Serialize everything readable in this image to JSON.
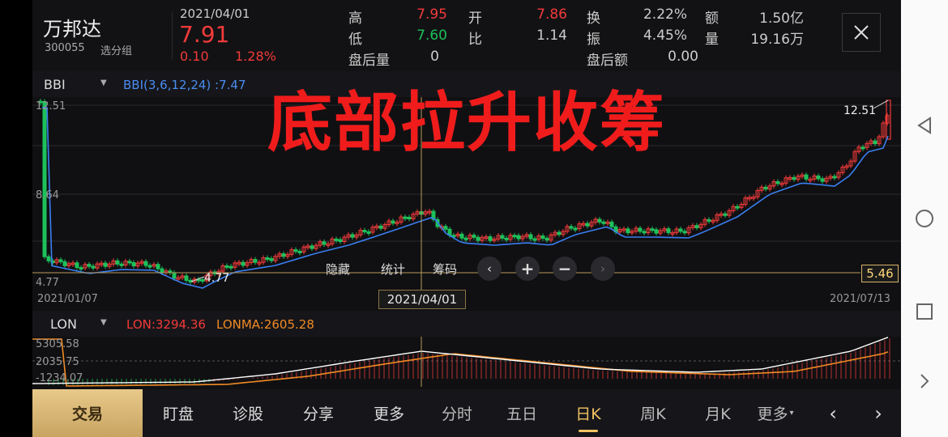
{
  "stock": {
    "name": "万邦达",
    "code": "300055",
    "group": "选分组",
    "date": "2021/04/01",
    "price": "7.91",
    "change": "0.10",
    "change_pct": "1.28%"
  },
  "quote": {
    "high_label": "高",
    "high": "7.95",
    "low_label": "低",
    "low": "7.60",
    "open_label": "开",
    "open": "7.86",
    "ratio_label": "比",
    "ratio": "1.14",
    "turnover_label": "换",
    "turnover": "2.22%",
    "amplitude_label": "振",
    "amplitude": "4.45%",
    "amount_label": "额",
    "amount": "1.50亿",
    "volume_label": "量",
    "volume": "19.16万",
    "after_vol_label": "盘后量",
    "after_vol": "0",
    "after_amt_label": "盘后额",
    "after_amt": "0.00"
  },
  "indicator1": {
    "name": "BBI",
    "values": "BBI(3,6,12,24) :7.47"
  },
  "main_chart": {
    "y_max_label": "12.51",
    "y_mid_label": "8.64",
    "y_min_label": "4.77",
    "high_marker": "12.51",
    "low_marker": "4.77",
    "start_date": "2021/01/07",
    "end_date": "2021/07/13",
    "cursor_date": "2021/04/01",
    "cursor_price": "5.46",
    "watermark": "底部拉升收筹"
  },
  "toolbar": {
    "hide": "隐藏",
    "stats": "统计",
    "chips": "筹码"
  },
  "indicator2": {
    "name": "LON",
    "lon": "LON:3294.36",
    "lonma": "LONMA:2605.28",
    "y_top": "5305.58",
    "y_mid": "2035.75",
    "y_bot": "-1234.07"
  },
  "tabs": {
    "trade": "交易",
    "watch": "盯盘",
    "diagnose": "诊股",
    "share": "分享",
    "more": "更多",
    "intraday": "分时",
    "five_day": "五日",
    "daily": "日K",
    "weekly": "周K",
    "monthly": "月K",
    "more2": "更多"
  },
  "colors": {
    "up": "#f23a3a",
    "down": "#1cc15a",
    "bbi": "#3a7ef0",
    "lon": "#ffffff",
    "lonma": "#f08a24",
    "accent": "#f2c263"
  }
}
